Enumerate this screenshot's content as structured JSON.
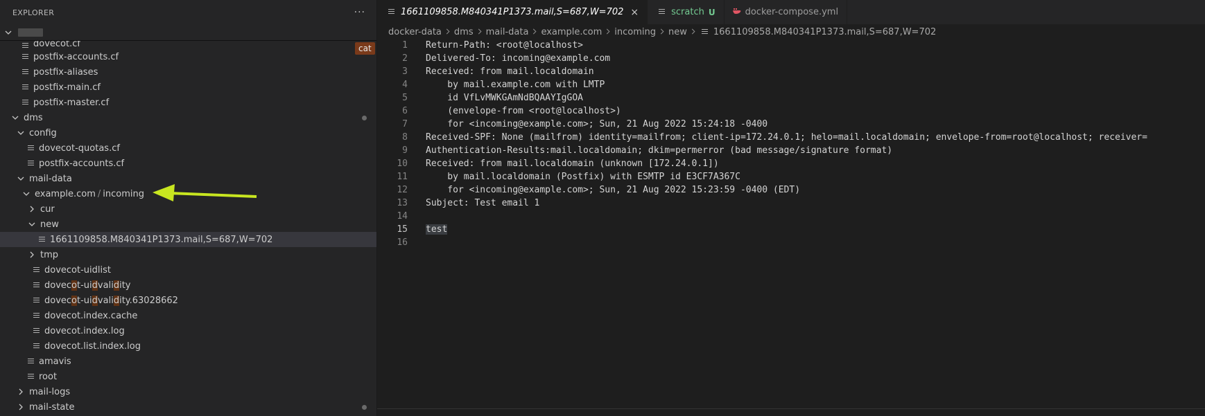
{
  "explorer": {
    "title": "EXPLORER",
    "more": "···",
    "badge": "cat",
    "tree": [
      {
        "label": "dovecot.cf",
        "depth": 2,
        "type": "file",
        "cut": true
      },
      {
        "label": "postfix-accounts.cf",
        "depth": 2,
        "type": "file"
      },
      {
        "label": "postfix-aliases",
        "depth": 2,
        "type": "file"
      },
      {
        "label": "postfix-main.cf",
        "depth": 2,
        "type": "file"
      },
      {
        "label": "postfix-master.cf",
        "depth": 2,
        "type": "file"
      },
      {
        "label": "dms",
        "depth": 1,
        "type": "folder",
        "open": true,
        "dot": true
      },
      {
        "label": "config",
        "depth": 2,
        "type": "folder",
        "open": true
      },
      {
        "label": "dovecot-quotas.cf",
        "depth": 3,
        "type": "file"
      },
      {
        "label": "postfix-accounts.cf",
        "depth": 3,
        "type": "file"
      },
      {
        "label": "mail-data",
        "depth": 2,
        "type": "folder",
        "open": true
      },
      {
        "label": "example.com",
        "sep": "/",
        "label2": "incoming",
        "depth": 3,
        "type": "folder",
        "open": true,
        "compact": true
      },
      {
        "label": "cur",
        "depth": 4,
        "type": "folder",
        "open": false
      },
      {
        "label": "new",
        "depth": 4,
        "type": "folder",
        "open": true
      },
      {
        "label": "1661109858.M840341P1373.mail,S=687,W=702",
        "depth": 5,
        "type": "file",
        "selected": true
      },
      {
        "label": "tmp",
        "depth": 4,
        "type": "folder",
        "open": false
      },
      {
        "label": "dovecot-uidlist",
        "depth": 4,
        "type": "file"
      },
      {
        "label": "dovecot-uidvalidity",
        "depth": 4,
        "type": "file",
        "hl": [
          5,
          10,
          15
        ]
      },
      {
        "label": "dovecot-uidvalidity.63028662",
        "depth": 4,
        "type": "file",
        "hl": [
          5,
          10,
          15
        ]
      },
      {
        "label": "dovecot.index.cache",
        "depth": 4,
        "type": "file"
      },
      {
        "label": "dovecot.index.log",
        "depth": 4,
        "type": "file"
      },
      {
        "label": "dovecot.list.index.log",
        "depth": 4,
        "type": "file"
      },
      {
        "label": "amavis",
        "depth": 3,
        "type": "file"
      },
      {
        "label": "root",
        "depth": 3,
        "type": "file"
      },
      {
        "label": "mail-logs",
        "depth": 2,
        "type": "folder",
        "open": false
      },
      {
        "label": "mail-state",
        "depth": 2,
        "type": "folder",
        "open": false,
        "dot": true
      }
    ]
  },
  "tabs": [
    {
      "label": "1661109858.M840341P1373.mail,S=687,W=702",
      "active": true,
      "italic": true,
      "close": "×",
      "icon": "file-lines-icon"
    },
    {
      "label": "scratch",
      "git": true,
      "status": "U",
      "icon": "file-lines-icon"
    },
    {
      "label": "docker-compose.yml",
      "icon": "docker-whale-icon"
    }
  ],
  "breadcrumbs": [
    "docker-data",
    "dms",
    "mail-data",
    "example.com",
    "incoming",
    "new",
    "1661109858.M840341P1373.mail,S=687,W=702"
  ],
  "code": {
    "current_line": 15,
    "lines": [
      "Return-Path: <root@localhost>",
      "Delivered-To: incoming@example.com",
      "Received: from mail.localdomain",
      "    by mail.example.com with LMTP",
      "    id VfLvMWKGAmNdBQAAYIgGOA",
      "    (envelope-from <root@localhost>)",
      "    for <incoming@example.com>; Sun, 21 Aug 2022 15:24:18 -0400",
      "Received-SPF: None (mailfrom) identity=mailfrom; client-ip=172.24.0.1; helo=mail.localdomain; envelope-from=root@localhost; receiver=",
      "Authentication-Results:mail.localdomain; dkim=permerror (bad message/signature format)",
      "Received: from mail.localdomain (unknown [172.24.0.1])",
      "    by mail.localdomain (Postfix) with ESMTP id E3CF7A367C",
      "    for <incoming@example.com>; Sun, 21 Aug 2022 15:23:59 -0400 (EDT)",
      "Subject: Test email 1",
      "",
      "test",
      ""
    ]
  },
  "colors": {
    "accent_arrow": "#c8e620",
    "badge": "#7a3a1a",
    "selected_row": "#37373d"
  }
}
